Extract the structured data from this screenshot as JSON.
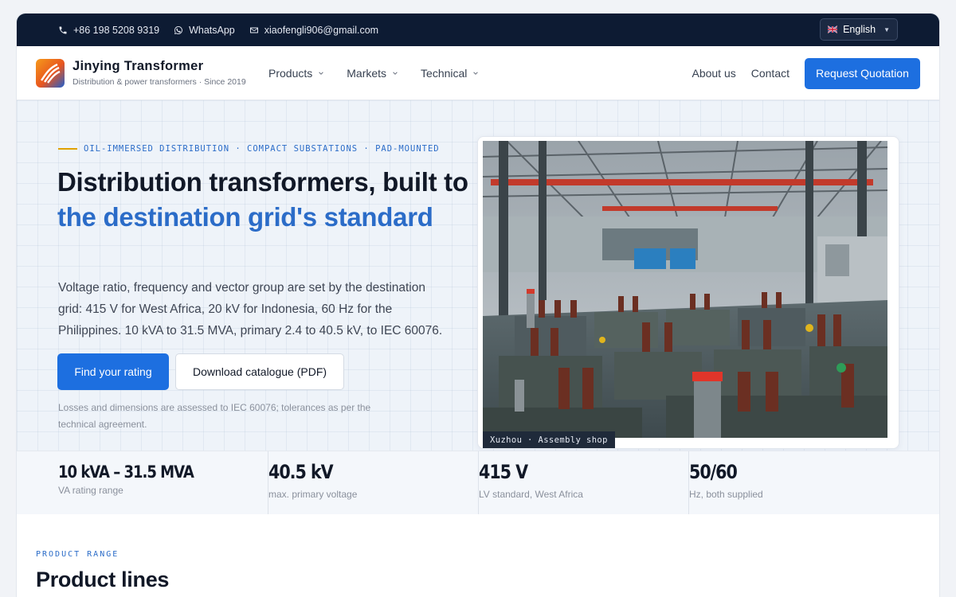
{
  "topbar": {
    "phone": "+86 198 5208 9319",
    "whatsapp": "WhatsApp",
    "email": "xiaofengli906@gmail.com",
    "language": "English"
  },
  "header": {
    "brand_name": "Jinying Transformer",
    "brand_sub": "Distribution & power transformers · Since 2019",
    "nav": [
      {
        "label": "Products"
      },
      {
        "label": "Markets"
      },
      {
        "label": "Technical"
      }
    ],
    "about": "About us",
    "contact": "Contact",
    "cta": "Request Quotation"
  },
  "hero": {
    "eyebrow": "OIL-IMMERSED DISTRIBUTION · COMPACT SUBSTATIONS · PAD-MOUNTED",
    "title_plain": "Distribution transformers, built to ",
    "title_accent": "the destination grid's standard",
    "lead": "Voltage ratio, frequency and vector group are set by the destination grid: 415 V for West Africa, 20 kV for Indonesia, 60 Hz for the Philippines. 10 kVA to 31.5 MVA, primary 2.4 to 40.5 kV, to IEC 60076.",
    "primary_button": "Find your rating",
    "secondary_button": "Download catalogue (PDF)",
    "note": "Losses and dimensions are assessed to IEC 60076; tolerances as per the technical agreement.",
    "photo_caption": "Xuzhou · Assembly shop"
  },
  "stats": [
    {
      "value": "10 kVA – 31.5 MVA",
      "label": "VA rating range"
    },
    {
      "value": "40.5 kV",
      "label": "max. primary voltage"
    },
    {
      "value": "415 V",
      "label": "LV standard, West Africa"
    },
    {
      "value": "50/60",
      "label": "Hz, both supplied"
    }
  ],
  "products": {
    "kicker": "PRODUCT RANGE",
    "title": "Product lines"
  },
  "colors": {
    "accent": "#1d6fe0",
    "topbar": "#0d1b33",
    "eyebrow_rule": "#e0a100"
  }
}
